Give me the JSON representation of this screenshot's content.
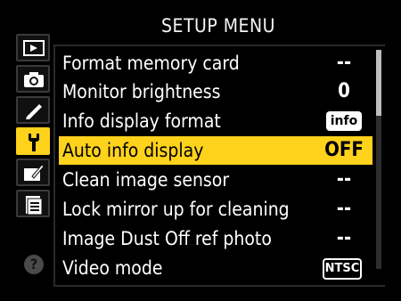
{
  "title": "SETUP MENU",
  "tabs": [
    {
      "name": "playback-menu-icon",
      "active": false
    },
    {
      "name": "shooting-menu-icon",
      "active": false
    },
    {
      "name": "custom-settings-icon",
      "active": false
    },
    {
      "name": "setup-menu-icon",
      "active": true
    },
    {
      "name": "retouch-menu-icon",
      "active": false
    },
    {
      "name": "my-menu-icon",
      "active": false
    }
  ],
  "help": "?",
  "items": [
    {
      "label": "Format memory card",
      "value": "--",
      "value_style": "plain"
    },
    {
      "label": "Monitor brightness",
      "value": "0",
      "value_style": "plain"
    },
    {
      "label": "Info display format",
      "value": "info",
      "value_style": "boxed"
    },
    {
      "label": "Auto info display",
      "value": "OFF",
      "value_style": "plain",
      "selected": true
    },
    {
      "label": "Clean image sensor",
      "value": "--",
      "value_style": "plain"
    },
    {
      "label": "Lock mirror up for cleaning",
      "value": "--",
      "value_style": "plain"
    },
    {
      "label": "Image Dust Off ref photo",
      "value": "--",
      "value_style": "plain"
    },
    {
      "label": "Video mode",
      "value": "NTSC",
      "value_style": "outlined"
    }
  ],
  "scrollbar": {
    "position_fraction": 0.0,
    "visible_fraction": 0.3
  },
  "colors": {
    "accent": "#ffd21c",
    "background": "#000000"
  }
}
